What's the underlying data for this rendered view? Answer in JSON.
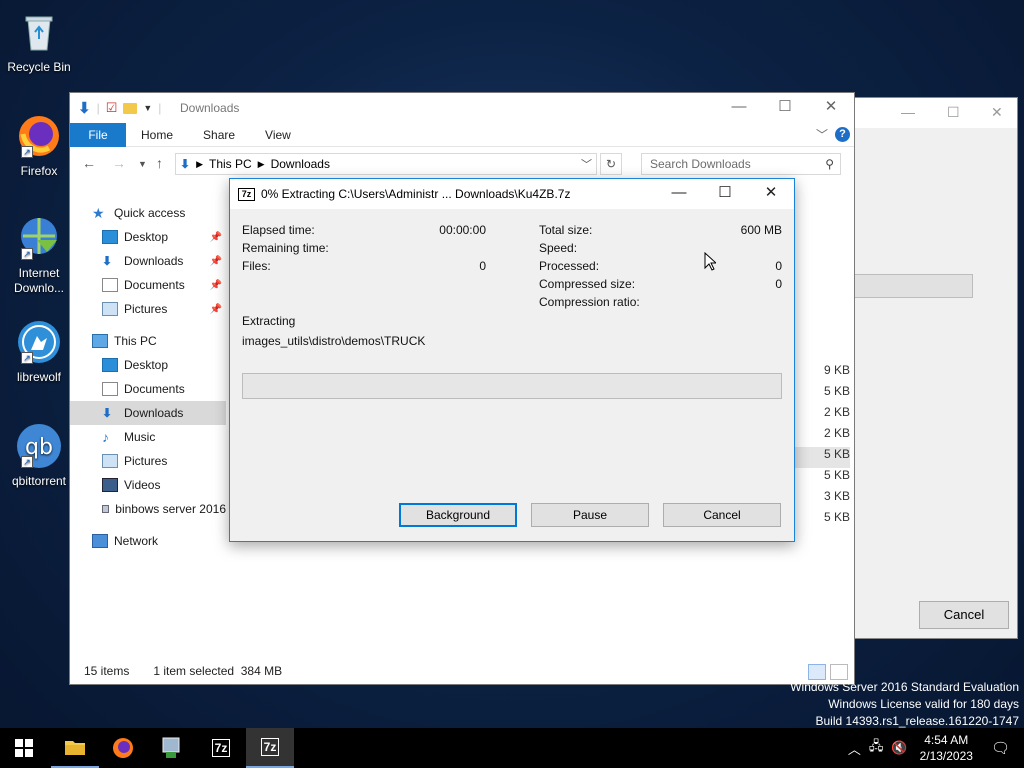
{
  "desktop": {
    "icons": [
      {
        "label": "Recycle Bin",
        "icon": "recycle-bin-icon"
      },
      {
        "label": "Firefox",
        "icon": "firefox-icon"
      },
      {
        "label": "Internet Downlo...",
        "icon": "internet-download-manager-icon"
      },
      {
        "label": "librewolf",
        "icon": "librewolf-icon"
      },
      {
        "label": "qbittorrent",
        "icon": "qbittorrent-icon"
      }
    ],
    "watermark": [
      "Windows Server 2016 Standard Evaluation",
      "Windows License valid for 180 days",
      "Build 14393.rs1_release.161220-1747"
    ]
  },
  "background_dialog": {
    "cancel_label": "Cancel"
  },
  "explorer": {
    "title": "Downloads",
    "ribbon": {
      "file": "File",
      "home": "Home",
      "share": "Share",
      "view": "View"
    },
    "address": {
      "root": "This PC",
      "current": "Downloads"
    },
    "search_placeholder": "Search Downloads",
    "nav": {
      "quick_access": "Quick access",
      "qa_desktop": "Desktop",
      "qa_downloads": "Downloads",
      "qa_documents": "Documents",
      "qa_pictures": "Pictures",
      "this_pc": "This PC",
      "pc_desktop": "Desktop",
      "pc_documents": "Documents",
      "pc_downloads": "Downloads",
      "pc_music": "Music",
      "pc_pictures": "Pictures",
      "pc_videos": "Videos",
      "pc_drive": "binbows server 2016",
      "network": "Network"
    },
    "file_sizes": [
      "9 KB",
      "5 KB",
      "2 KB",
      "2 KB",
      "5 KB",
      "5 KB",
      "3 KB",
      "5 KB"
    ],
    "status": {
      "items": "15 items",
      "selected": "1 item selected  384 MB"
    }
  },
  "extract_dialog": {
    "title": "0% Extracting C:\\Users\\Administr ... Downloads\\Ku4ZB.7z",
    "logo": "7z",
    "labels": {
      "elapsed": "Elapsed time:",
      "remaining": "Remaining time:",
      "files": "Files:",
      "total_size": "Total size:",
      "speed": "Speed:",
      "processed": "Processed:",
      "compressed": "Compressed size:",
      "ratio": "Compression ratio:"
    },
    "values": {
      "elapsed": "00:00:00",
      "files": "0",
      "total_size": "600 MB",
      "processed": "0",
      "compressed": "0"
    },
    "status_label": "Extracting",
    "current_file": "images_utils\\distro\\demos\\TRUCK",
    "progress_fraction": 0,
    "buttons": {
      "background": "Background",
      "pause": "Pause",
      "cancel": "Cancel"
    }
  },
  "taskbar": {
    "apps": [
      "start-icon",
      "file-explorer-icon",
      "firefox-icon",
      "network-app-icon",
      "7zip-icon",
      "7zip-icon"
    ],
    "logo_7z": "7z",
    "clock": {
      "time": "4:54 AM",
      "date": "2/13/2023"
    }
  }
}
